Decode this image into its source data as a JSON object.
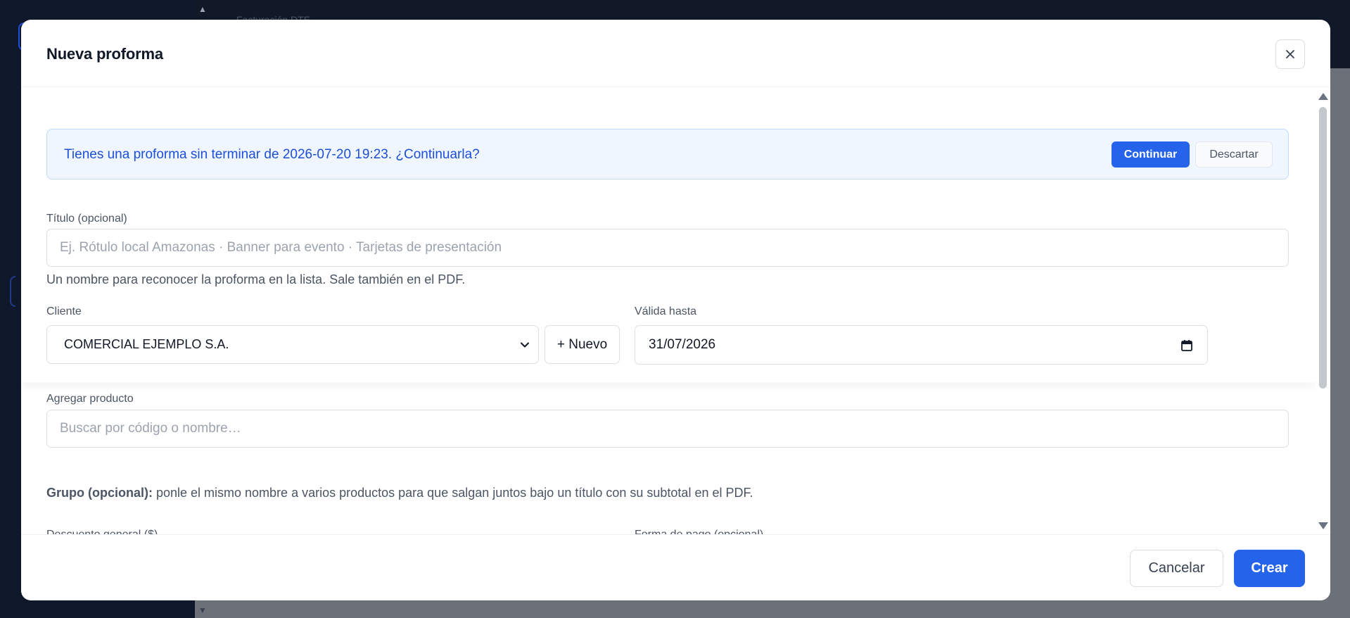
{
  "background": {
    "ghost_text": "Facturación DTE"
  },
  "modal": {
    "title": "Nueva proforma",
    "close_icon": "close-icon"
  },
  "draft_banner": {
    "text": "Tienes una proforma sin terminar de 2026-07-20 19:23. ¿Continuarla?",
    "continue_label": "Continuar",
    "discard_label": "Descartar"
  },
  "form": {
    "title_label": "Título (opcional)",
    "title_placeholder": "Ej. Rótulo local Amazonas · Banner para evento · Tarjetas de presentación",
    "title_helper": "Un nombre para reconocer la proforma en la lista. Sale también en el PDF.",
    "client_label": "Cliente",
    "client_value": "COMERCIAL EJEMPLO S.A.",
    "new_client_label": "+ Nuevo",
    "valid_until_label": "Válida hasta",
    "valid_until_value": "31/07/2026",
    "add_product_label": "Agregar producto",
    "add_product_placeholder": "Buscar por código o nombre…",
    "group_note_bold": "Grupo (opcional):",
    "group_note_text": " ponle el mismo nombre a varios productos para que salgan juntos bajo un título con su subtotal en el PDF.",
    "discount_label": "Descuento general ($)",
    "payment_label": "Forma de pago (opcional)"
  },
  "footer": {
    "cancel_label": "Cancelar",
    "create_label": "Crear"
  },
  "colors": {
    "primary": "#2563eb",
    "banner_bg": "#eff6ff",
    "banner_text": "#1d4ed8"
  }
}
